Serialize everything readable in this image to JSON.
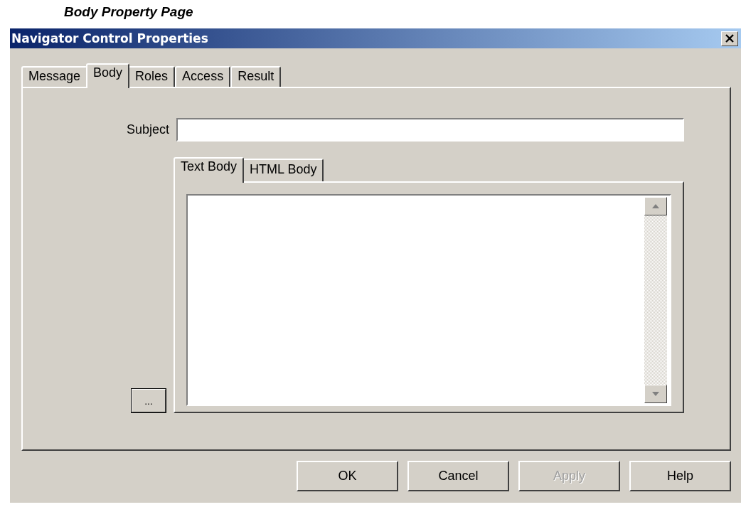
{
  "caption": "Body Property Page",
  "window": {
    "title": "Navigator Control Properties"
  },
  "tabs": [
    {
      "label": "Message",
      "selected": false
    },
    {
      "label": "Body",
      "selected": true
    },
    {
      "label": "Roles",
      "selected": false
    },
    {
      "label": "Access",
      "selected": false
    },
    {
      "label": "Result",
      "selected": false
    }
  ],
  "subject": {
    "label": "Subject"
  },
  "body_tabs": [
    {
      "label": "Text Body",
      "selected": true
    },
    {
      "label": "HTML Body",
      "selected": false
    }
  ],
  "browse_button": "...",
  "buttons": [
    {
      "label": "OK",
      "disabled": false
    },
    {
      "label": "Cancel",
      "disabled": false
    },
    {
      "label": "Apply",
      "disabled": true
    },
    {
      "label": "Help",
      "disabled": false
    }
  ]
}
